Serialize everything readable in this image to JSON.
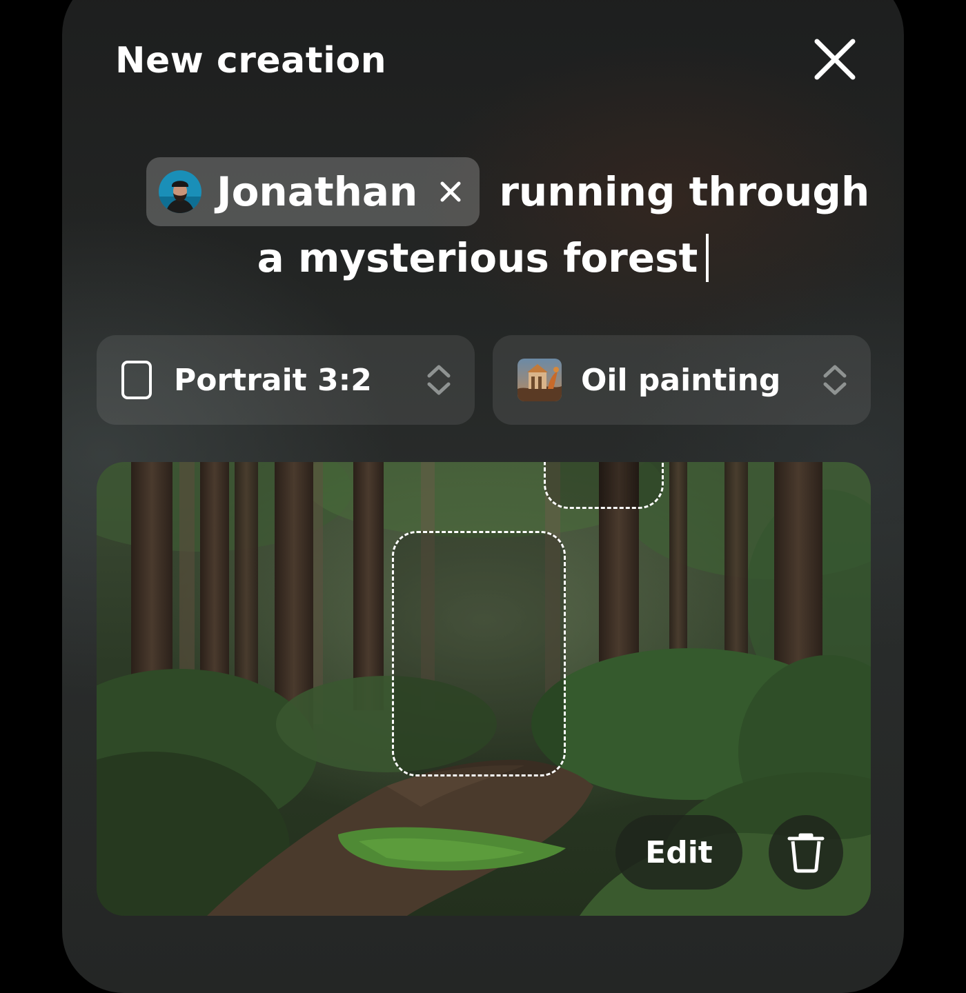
{
  "header": {
    "title": "New creation",
    "close_icon": "close-icon"
  },
  "prompt": {
    "mention_name": "Jonathan",
    "mention_remove_icon": "close-small-icon",
    "text_line1": "running through",
    "text_line2": "a mysterious forest"
  },
  "options": {
    "aspect": {
      "label": "Portrait 3:2",
      "icon": "portrait-frame-icon"
    },
    "style": {
      "label": "Oil painting",
      "icon": "style-thumbnail"
    },
    "chevron_icon": "chevron-up-down-icon"
  },
  "image": {
    "edit_label": "Edit",
    "delete_icon": "trash-icon"
  },
  "colors": {
    "background": "#000000",
    "panel": "#232524",
    "text": "#ffffff"
  }
}
